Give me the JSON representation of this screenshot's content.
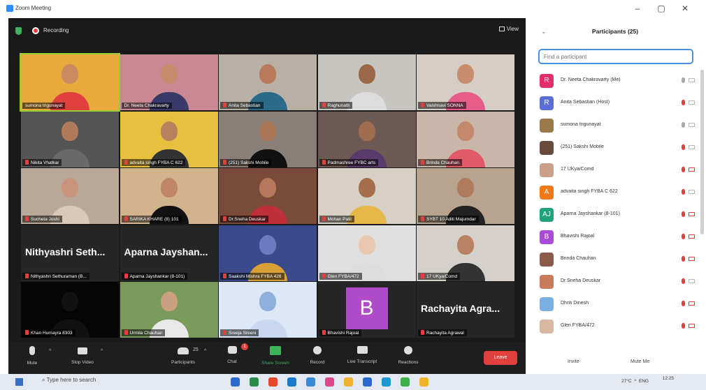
{
  "window": {
    "title": "Zoom Meeting",
    "controls": [
      "–",
      "▢",
      "✕"
    ]
  },
  "meeting": {
    "status": "Recording",
    "view_label": "View",
    "tiles": [
      {
        "name": "sumona trigunayat",
        "type": "video",
        "active": true,
        "muted": false,
        "skin": "#c88a5e",
        "body": "#e0413d",
        "bg": "#e9a93c"
      },
      {
        "name": "Dr. Neeta Chakravarty",
        "type": "video",
        "muted": false,
        "skin": "#c48c6a",
        "body": "#3a3a6a",
        "bg": "#c98894"
      },
      {
        "name": "Anita Sebastian",
        "type": "video",
        "muted": true,
        "skin": "#b77a5b",
        "body": "#2c6a8a",
        "bg": "#b8b0a4"
      },
      {
        "name": "Raghunath",
        "type": "video",
        "muted": true,
        "skin": "#9b6848",
        "body": "#ddd",
        "bg": "#c8c4c0"
      },
      {
        "name": "Vaishnavi SONNA",
        "type": "video",
        "muted": true,
        "skin": "#c78e6e",
        "body": "#e75d8a",
        "bg": "#d6cec6"
      },
      {
        "name": "Nikita Vhatkar",
        "type": "video",
        "muted": true,
        "skin": "#b07a58",
        "body": "#6a6a6a",
        "bg": "#555"
      },
      {
        "name": "advaita singh FYBA C 622",
        "type": "video",
        "muted": true,
        "skin": "#b9825f",
        "body": "#333",
        "bg": "#e8c040"
      },
      {
        "name": "(251) Sakshi Mobile",
        "type": "video",
        "muted": true,
        "skin": "#a97656",
        "body": "#111",
        "bg": "#8a7f76"
      },
      {
        "name": "Padmashree FYBC arts",
        "type": "video",
        "muted": true,
        "skin": "#a06e4e",
        "body": "#5a3a6a",
        "bg": "#6e5a55"
      },
      {
        "name": "Brinda Chauhan",
        "type": "video",
        "muted": true,
        "skin": "#c28a6a",
        "body": "#e05a6a",
        "bg": "#c9b6a8"
      },
      {
        "name": "Sucheta Joshi",
        "type": "video",
        "muted": true,
        "skin": "#c8957a",
        "body": "#d8c8b8",
        "bg": "#b9a898"
      },
      {
        "name": "SARIKA KHARE (8) 101",
        "type": "video",
        "muted": true,
        "skin": "#c08664",
        "body": "#111",
        "bg": "#d2b48c"
      },
      {
        "name": "Dr.Sneha Deuskar",
        "type": "video",
        "muted": true,
        "skin": "#b6785a",
        "body": "#c0303a",
        "bg": "#7a4a3a"
      },
      {
        "name": "Mohan Patil",
        "type": "video",
        "muted": true,
        "skin": "#a56e4b",
        "body": "#e6b84a",
        "bg": "#d8d0c4"
      },
      {
        "name": "SYBT 10 Aditi Majumdar",
        "type": "video",
        "muted": true,
        "skin": "#b07a5c",
        "body": "#222",
        "bg": "#b8a48e"
      },
      {
        "name": "Nithyashri Sethuraman (B...",
        "type": "name",
        "bigname": "Nithyashri  Seth...",
        "muted": true
      },
      {
        "name": "Aparna Jayshankar (8-101)",
        "type": "name",
        "bigname": "Aparna  Jayshan...",
        "muted": true
      },
      {
        "name": "Saakshi Mishra FYBA 426",
        "type": "video",
        "muted": true,
        "skin": "#6a7bc2",
        "body": "#d9a036",
        "bg": "#3a4a8a"
      },
      {
        "name": "Glen FYBA/472",
        "type": "video",
        "muted": true,
        "skin": "#e8c8b0",
        "body": "#ddd",
        "bg": "#e0e0e0"
      },
      {
        "name": "17 UKya/Comd",
        "type": "video",
        "muted": true,
        "skin": "#b98262",
        "body": "#333",
        "bg": "#d6d0ca"
      },
      {
        "name": "Khan Humayra 8303",
        "type": "video",
        "muted": true,
        "skin": "#111",
        "body": "#111",
        "bg": "#050505"
      },
      {
        "name": "Urmila Chauhan",
        "type": "video",
        "muted": true,
        "skin": "#c9a080",
        "body": "#e8e8e8",
        "bg": "#7a9a5a"
      },
      {
        "name": "Sreeja Sreeni",
        "type": "video",
        "muted": true,
        "skin": "#8fb0dc",
        "body": "#c8d8f0",
        "bg": "#dce8f6"
      },
      {
        "name": "Bhavishi Rajoal",
        "type": "avatar",
        "letter": "B",
        "muted": true
      },
      {
        "name": "Rachayita Agrawal",
        "type": "name",
        "bigname": "Rachayita  Agra...",
        "muted": true
      }
    ]
  },
  "toolbar": {
    "mute": "Mute",
    "stop_video": "Stop Video",
    "participants": "Participants",
    "participants_count": "25",
    "chat": "Chat",
    "chat_badge": "1",
    "share_screen": "Share Screen",
    "record": "Record",
    "live_transcript": "Live Transcript",
    "reactions": "Reactions",
    "leave": "Leave"
  },
  "participants_panel": {
    "title": "Participants (25)",
    "search_placeholder": "Find a participant",
    "invite": "Invite",
    "mute_me": "Mute Me",
    "list": [
      {
        "name": "Dr. Neeta Chakravarty (Me)",
        "avatar_letter": "R",
        "avatar_color": "#e0306a",
        "mic": "on",
        "cam": "on"
      },
      {
        "name": "Anita Sebastian (Host)",
        "avatar_letter": "R",
        "avatar_color": "#5b6fd6",
        "mic": "off",
        "cam": "on"
      },
      {
        "name": "sumona trigunayat",
        "avatar_letter": "",
        "avatar_color": "#9a7a4a",
        "mic": "on",
        "cam": "on"
      },
      {
        "name": "(251) Sakshi Mobile",
        "avatar_letter": "",
        "avatar_color": "#6a4a3a",
        "mic": "off",
        "cam": "on"
      },
      {
        "name": "17 UKya/Comd",
        "avatar_letter": "",
        "avatar_color": "#c9a08a",
        "mic": "off",
        "cam": "off"
      },
      {
        "name": "advaita singh FYBA C 622",
        "avatar_letter": "A",
        "avatar_color": "#f07a1a",
        "mic": "off",
        "cam": "on"
      },
      {
        "name": "Aparna Jayshankar (8-101)",
        "avatar_letter": "AJ",
        "avatar_color": "#1fa37a",
        "mic": "off",
        "cam": "off"
      },
      {
        "name": "Bhavishi Rajoal",
        "avatar_letter": "B",
        "avatar_color": "#a94bd6",
        "mic": "off",
        "cam": "off"
      },
      {
        "name": "Brinda Chauhan",
        "avatar_letter": "",
        "avatar_color": "#8a5a4a",
        "mic": "off",
        "cam": "off"
      },
      {
        "name": "Dr.Sneha Deuskar",
        "avatar_letter": "",
        "avatar_color": "#c97a5a",
        "mic": "off",
        "cam": "on"
      },
      {
        "name": "Dhriti Dinesh",
        "avatar_letter": "",
        "avatar_color": "#7ab0e0",
        "mic": "off",
        "cam": "off"
      },
      {
        "name": "Glen FYBA/472",
        "avatar_letter": "",
        "avatar_color": "#d8b8a0",
        "mic": "off",
        "cam": "off"
      }
    ]
  },
  "taskbar": {
    "search_placeholder": "Type here to search",
    "weather": "27°C",
    "lang": "ENG",
    "time": "12:25",
    "icon_colors": [
      "#2a6ad0",
      "#2a8a4a",
      "#e04a2a",
      "#1a7ad0",
      "#3a8ad8",
      "#d84a8a",
      "#f0b030",
      "#2a6ad0",
      "#1a9ad0",
      "#3ab04a",
      "#f0b030"
    ]
  }
}
